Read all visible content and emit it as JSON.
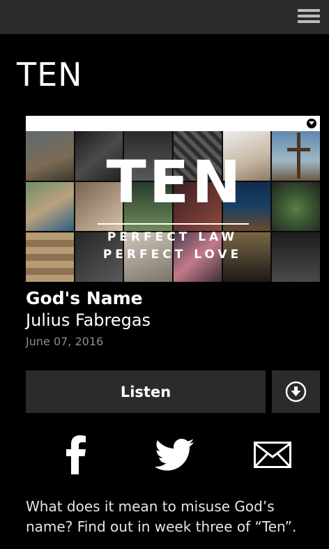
{
  "header": {
    "menu_icon": "hamburger-menu-icon"
  },
  "page": {
    "title": "TEN"
  },
  "artwork": {
    "logo_text": "TEN",
    "subtitle_line1": "PERFECT LAW",
    "subtitle_line2": "PERFECT LOVE",
    "dropdown_icon": "chevron-down-icon"
  },
  "sermon": {
    "title": "God's Name",
    "speaker": "Julius Fabregas",
    "date": "June 07, 2016",
    "description": "What does it mean to misuse God’s name? Find out in week three of “Ten”."
  },
  "actions": {
    "listen_label": "Listen",
    "download_icon": "download-icon"
  },
  "share": {
    "facebook_icon": "facebook-icon",
    "twitter_icon": "twitter-icon",
    "email_icon": "email-icon"
  },
  "colors": {
    "background": "#000000",
    "bar": "#2b2b2b",
    "date_text": "#8c8c8c"
  }
}
